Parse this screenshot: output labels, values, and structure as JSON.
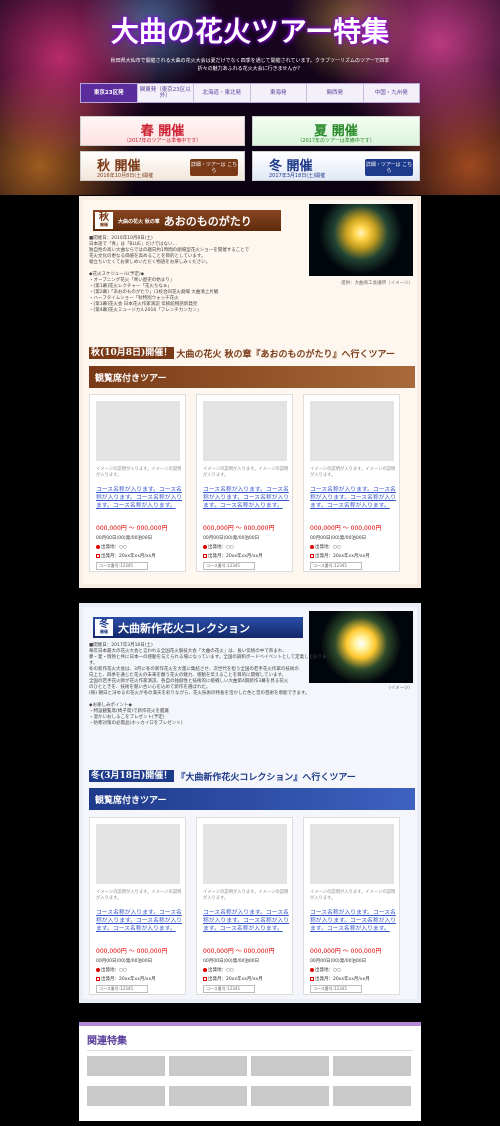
{
  "hero": {
    "title": "大曲の花火ツアー特集",
    "intro": "秋田県大仙市で開催される大曲の花火大会は夏だけでなく四季を通じて開催されています。クラブツーリズムのツアーで四季折々の魅力あふれる花火大会に行きませんか？"
  },
  "regions": [
    "東京23区発",
    "関東発（東京23区以外）",
    "北海道・東北発",
    "東海発",
    "関西発",
    "中国・九州発"
  ],
  "seasons": {
    "spring": {
      "name": "春 開催",
      "sub": "（2017年のツアーは準備中です）"
    },
    "summer": {
      "name": "夏 開催",
      "sub": "（2017年のツアーは準備中です）"
    },
    "autumn": {
      "name": "秋 開催",
      "sub": "2016年10月8日(土)開催",
      "btn": "詳細・ツアーは こちら"
    },
    "winter": {
      "name": "冬 開催",
      "sub": "2017年3月18日(土)開催",
      "btn": "詳細・ツアーは こちら"
    }
  },
  "autumn": {
    "kanji": "秋",
    "kanji_sub": "開催",
    "sub": "大曲の花火 秋の章",
    "title": "あおのものがたり",
    "date_line": "■開催日：2016年10月8日(土)",
    "text": [
      "日本語で「青」は「BLUE」だけではない…",
      "独自性の高い大曲ならではの趣向約1時間の劇場型花火ショーを開催することで",
      "花火文化の更なる価値を高めることを目的としています。",
      "嘘立ちいたくてお楽しめいただく物語をお楽しみください。",
      "",
      "◆花火スケジュール(予定)◆",
      "・オープニング花火「青い歴史の始まり」",
      "・[第1幕]花火レクチャー「花火ちなぁ」",
      "・[第2幕]「あおのものがたり」(3校合同花火劇場 大曲清上片観",
      "・ハーフタイムショー「秋特別ウォッチ花火",
      "・[第3幕]花火会 日本花火作家演説 伝統館物語新発見",
      "・[第4幕]花火ミュージカル2016「フレンチカンカン」"
    ],
    "caption": "提供：大曲商工会議所（イメージ）",
    "lead_date": "秋(10月8日)開催！",
    "lead_text": "大曲の花火 秋の章『あおのものがたり』へ行くツアー",
    "bar": "観覧席付きツアー"
  },
  "winter": {
    "kanji": "冬",
    "kanji_sub": "開催",
    "title": "大曲新作花火コレクション",
    "date_line": "■開催日：2017年3月18日(土)",
    "text": [
      "毎年日本最大の花火大会と言われる全国花火競技大会「大曲の花火」は、長い伝統の中で育まれ、",
      "夢・愛・情熱と共に日本一の感動を与えられる場になっています。全国の調和ボードベイベントとして定着しております。",
      "冬の新作花火大会は、3月に冬の新作花火を大量に集結させ、次世代を担う全国の若手花火作家の技術の",
      "向上と、四季を通じた花火の未来を願う花火の魅力、感動を伝えることを目的に開催しています。",
      "全国の若手花火師が花火作家演説、各自の独創性と技術的に挑戦しい大曲第4期新作3幕を見る花火",
      "のひとときを、技術を競い合い心を込めて新作を選ばれた。",
      "(毎) 朝日と冴ゆるの花火が冬の満天を彩りながら、花火技術の特長を活かした色と音の芸術を堪能できます。",
      "",
      "◆お楽しみポイント◆",
      "・特設観覧席(椅子席)で新作花火を鑑賞",
      "・温かいおしるこをプレゼント(予定)",
      "・防寒対策の必需品(ホッカイロをプレゼント)"
    ],
    "caption": "（イメージ）",
    "lead_date": "冬(3月18日)開催！",
    "lead_text": "『大曲新作花火コレクション』へ行くツアー",
    "bar": "観覧席付きツアー"
  },
  "tour_card": {
    "desc": "イメージの説明が入ります。イメージの説明が入ります。",
    "name": "コース名称が入ります。コース名称が入ります。コース名称が入ります。コース名称が入ります。",
    "price": "000,000円 〜 000,000円",
    "date": "00月00日(00)発/00泊00日",
    "dep": "出発地：○○",
    "dp": "出発月：20xx年xx月/xx月",
    "code": "コース番号:12345"
  },
  "related": {
    "title": "関連特集"
  },
  "colors": {
    "purple": "#5b2d9c",
    "autumn": "#7a3a17",
    "winter": "#1e3a8a",
    "spring_red": "#cc2233",
    "summer_green": "#2a8a2a"
  }
}
